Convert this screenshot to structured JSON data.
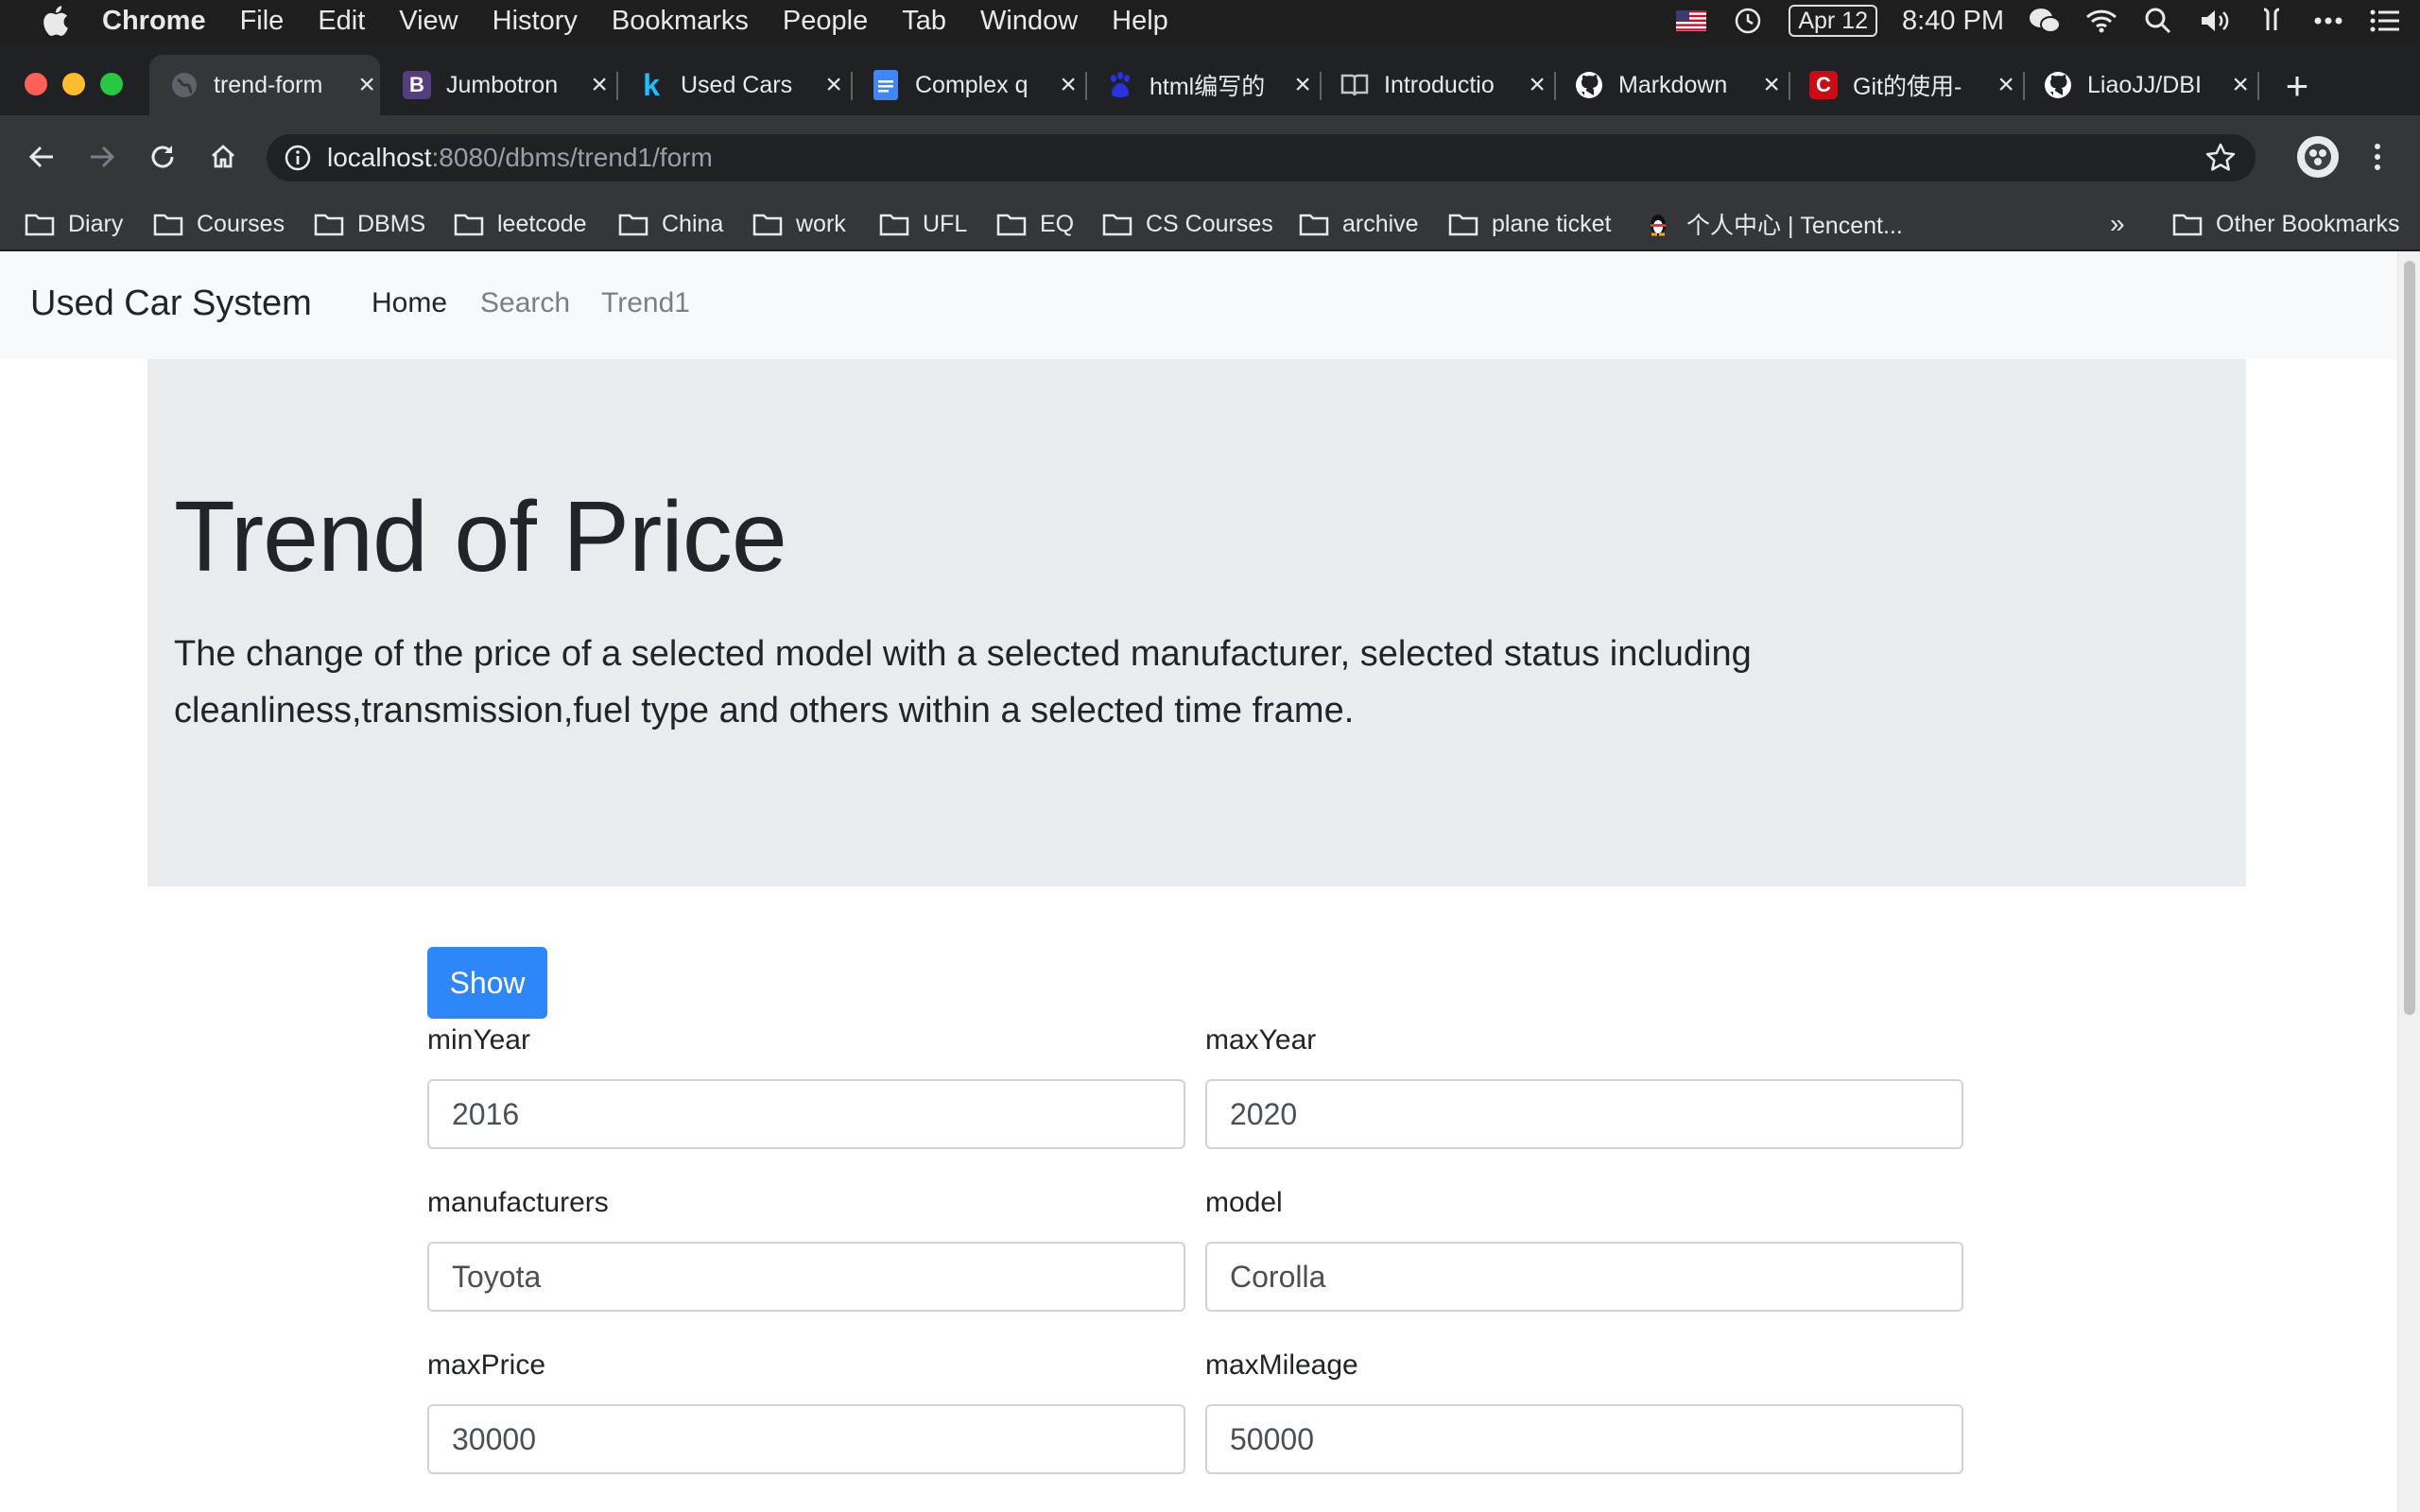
{
  "menubar": {
    "app": "Chrome",
    "items": [
      "File",
      "Edit",
      "View",
      "History",
      "Bookmarks",
      "People",
      "Tab",
      "Window",
      "Help"
    ],
    "date": "Apr 12",
    "time": "8:40 PM"
  },
  "tabs": [
    {
      "title": "trend-form",
      "icon": "globe-icon",
      "color": "#5f6368"
    },
    {
      "title": "Jumbotron",
      "icon": "bootstrap-icon",
      "color": "#563d7c",
      "glyph": "B"
    },
    {
      "title": "Used Cars",
      "icon": "kaggle-icon",
      "color": "#20beff",
      "glyph": "k"
    },
    {
      "title": "Complex q",
      "icon": "google-docs-icon",
      "color": "#4285f4"
    },
    {
      "title": "html编写的",
      "icon": "baidu-icon",
      "color": "#2932e1"
    },
    {
      "title": "Introductio",
      "icon": "book-icon",
      "color": "#9aa0a6"
    },
    {
      "title": "Markdown",
      "icon": "github-icon",
      "color": "#ffffff"
    },
    {
      "title": "Git的使用-",
      "icon": "csdn-icon",
      "color": "#ca0c16",
      "glyph": "C"
    },
    {
      "title": "LiaoJJ/DBI",
      "icon": "github-icon",
      "color": "#ffffff"
    }
  ],
  "toolbar": {
    "url_host": "localhost",
    "url_path": ":8080/dbms/trend1/form"
  },
  "bookmarks": [
    "Diary",
    "Courses",
    "DBMS",
    "leetcode",
    "China",
    "work",
    "UFL",
    "EQ",
    "CS Courses",
    "archive",
    "plane ticket",
    "个人中心 | Tencent...",
    "»",
    "Other Bookmarks"
  ],
  "navbar": {
    "brand": "Used Car System",
    "links": [
      "Home",
      "Search",
      "Trend1"
    ]
  },
  "jumbotron": {
    "title": "Trend of Price",
    "description": "The change of the price of a selected model with a selected manufacturer, selected status including cleanliness,transmission,fuel type and others within a selected time frame."
  },
  "form": {
    "show_label": "Show",
    "fields": [
      {
        "label": "minYear",
        "value": "2016"
      },
      {
        "label": "maxYear",
        "value": "2020"
      },
      {
        "label": "manufacturers",
        "value": "Toyota"
      },
      {
        "label": "model",
        "value": "Corolla"
      },
      {
        "label": "maxPrice",
        "value": "30000"
      },
      {
        "label": "maxMileage",
        "value": "50000"
      }
    ]
  },
  "colors": {
    "primary": "#2f86f6",
    "jumbotron_bg": "#e9ecef",
    "navbar_bg": "#f8f9fa"
  }
}
